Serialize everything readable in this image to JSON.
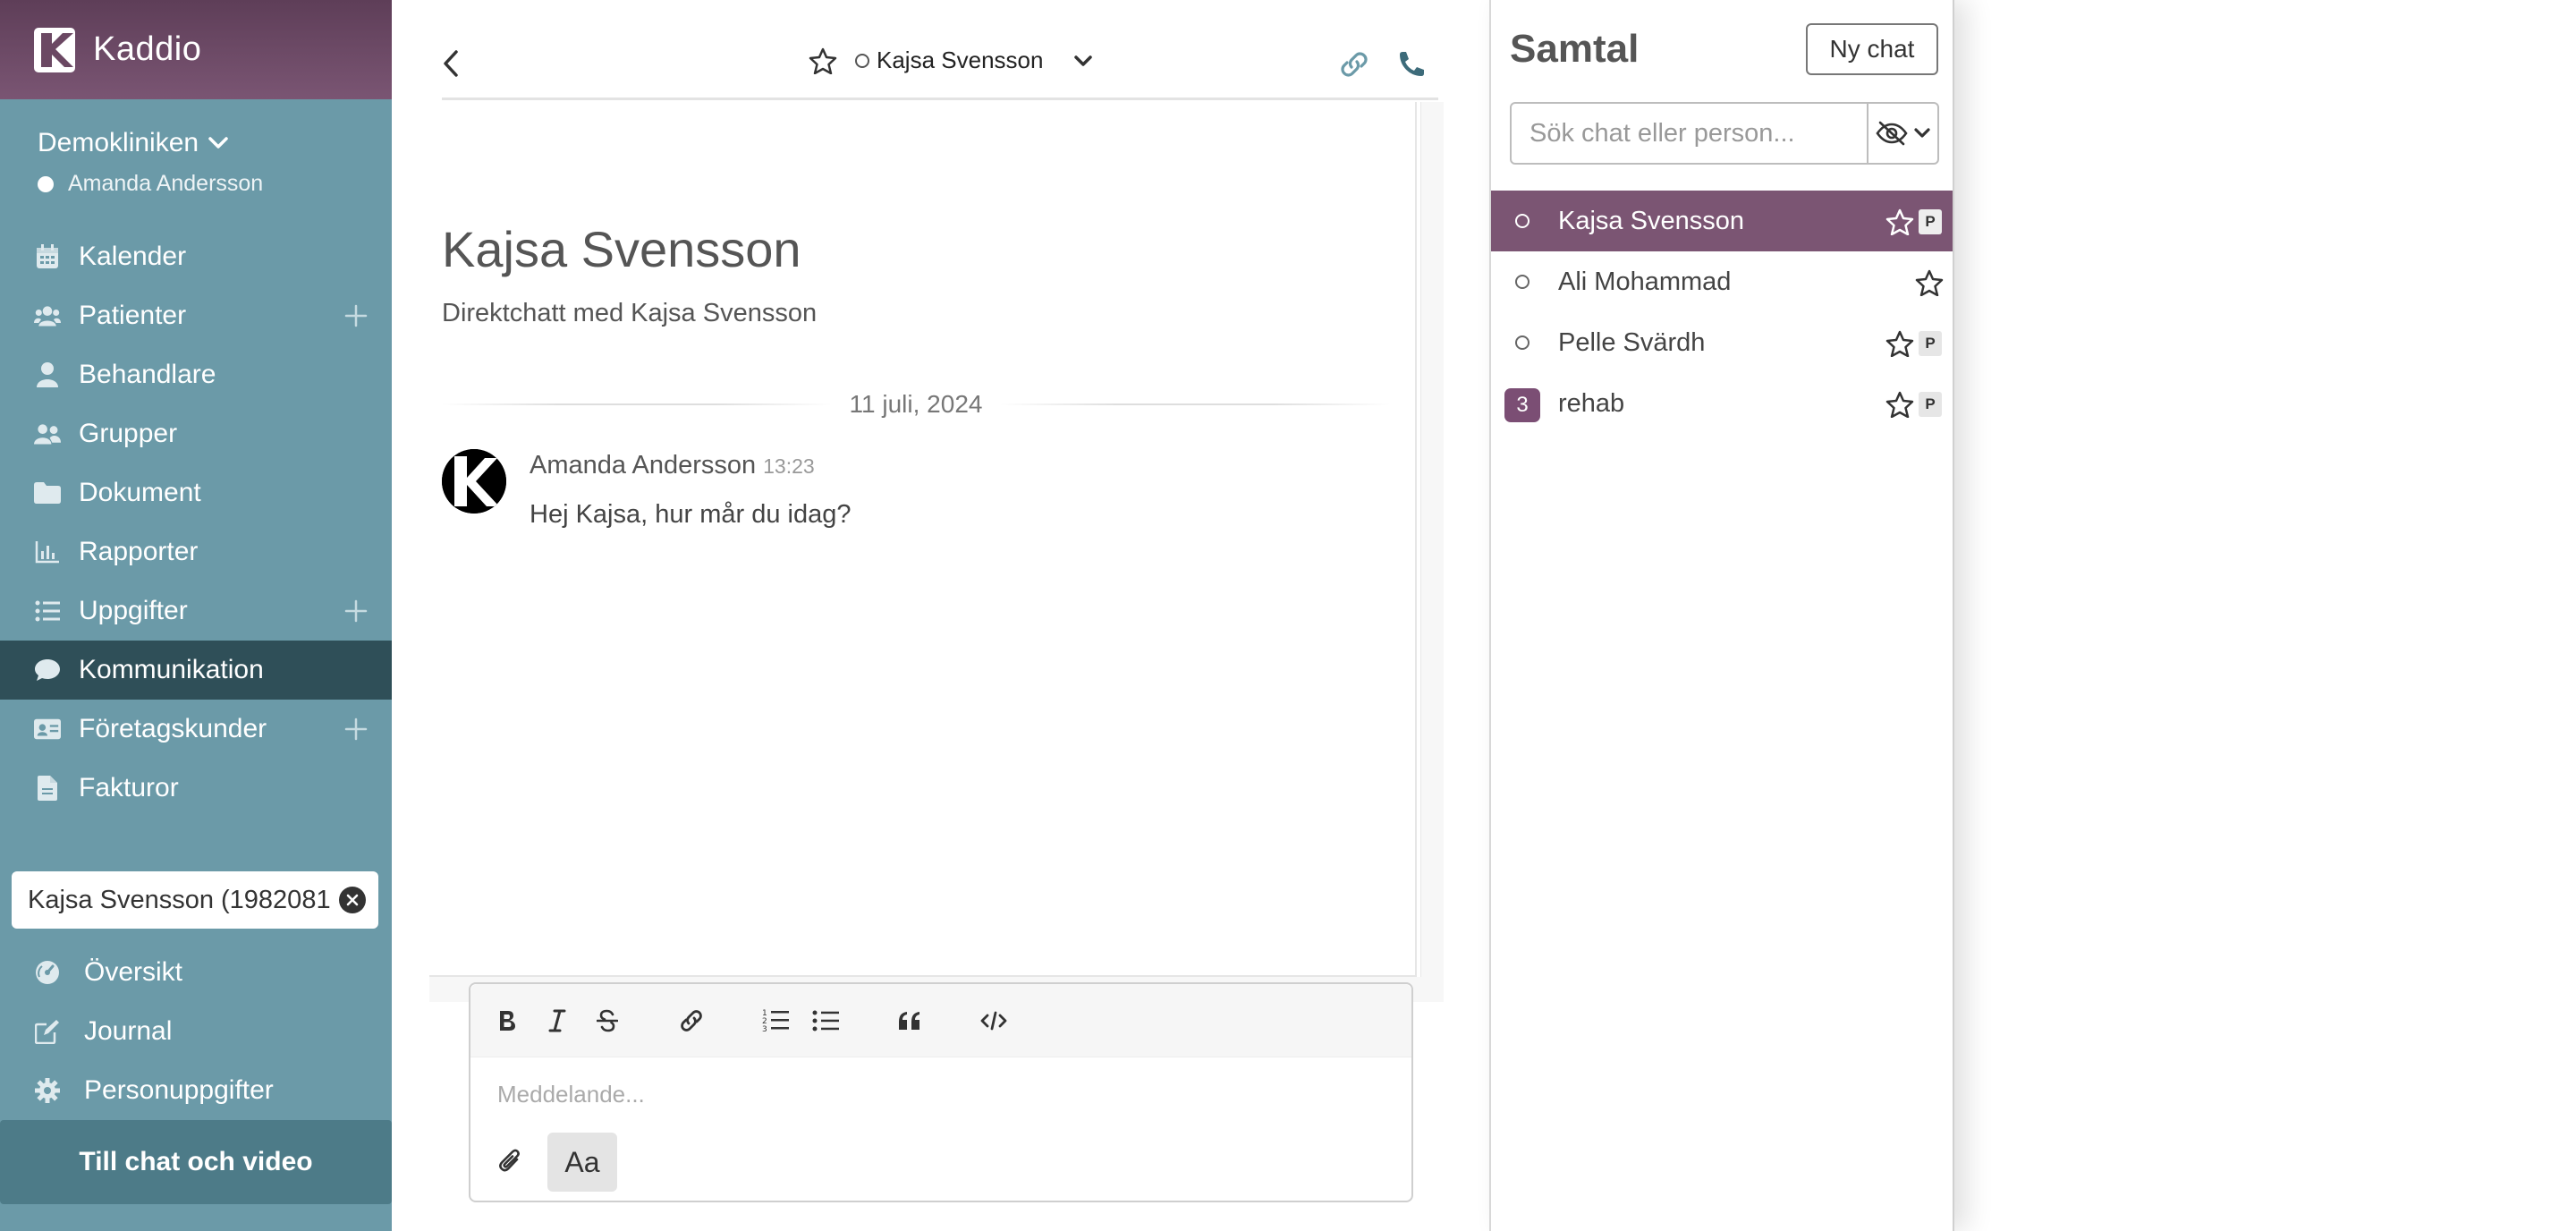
{
  "app": {
    "name": "Kaddio",
    "clinic": "Demokliniken",
    "current_user": "Amanda Andersson"
  },
  "nav": {
    "items": [
      {
        "label": "Kalender",
        "icon": "calendar-icon"
      },
      {
        "label": "Patienter",
        "icon": "users-icon",
        "has_add": true
      },
      {
        "label": "Behandlare",
        "icon": "user-icon"
      },
      {
        "label": "Grupper",
        "icon": "group-icon"
      },
      {
        "label": "Dokument",
        "icon": "folder-icon"
      },
      {
        "label": "Rapporter",
        "icon": "chart-icon"
      },
      {
        "label": "Uppgifter",
        "icon": "list-icon",
        "has_add": true
      },
      {
        "label": "Kommunikation",
        "icon": "chat-bubble-icon",
        "active": true
      },
      {
        "label": "Företagskunder",
        "icon": "id-card-icon",
        "has_add": true
      },
      {
        "label": "Fakturor",
        "icon": "file-icon"
      }
    ]
  },
  "patient_chip": {
    "text": "Kajsa Svensson (19820814"
  },
  "patient_nav": {
    "items": [
      {
        "label": "Översikt",
        "icon": "dashboard-icon"
      },
      {
        "label": "Journal",
        "icon": "edit-icon"
      },
      {
        "label": "Personuppgifter",
        "icon": "gear-icon"
      }
    ]
  },
  "chat_video_button": "Till chat och video",
  "chat": {
    "header_name": "Kajsa Svensson",
    "title": "Kajsa Svensson",
    "subtitle": "Direktchatt med Kajsa Svensson",
    "date_separator": "11 juli, 2024",
    "messages": [
      {
        "author": "Amanda Andersson",
        "time": "13:23",
        "text": "Hej Kajsa, hur mår du idag?"
      }
    ],
    "composer_placeholder": "Meddelande...",
    "format_button": "Aa"
  },
  "conversations": {
    "title": "Samtal",
    "new_chat_label": "Ny chat",
    "search_placeholder": "Sök chat eller person...",
    "items": [
      {
        "name": "Kajsa Svensson",
        "selected": true,
        "pinned": true,
        "pin_label": "P"
      },
      {
        "name": "Ali Mohammad",
        "selected": false,
        "pinned": false
      },
      {
        "name": "Pelle Svärdh",
        "selected": false,
        "pinned": true,
        "pin_label": "P"
      },
      {
        "name": "rehab",
        "selected": false,
        "pinned": true,
        "pin_label": "P",
        "unread": "3"
      }
    ]
  },
  "colors": {
    "sidebar": "#6b9aa8",
    "sidebar_active": "#2f4f58",
    "brand_purple": "#7b5573",
    "header_gradient_top": "#5e3e58"
  }
}
